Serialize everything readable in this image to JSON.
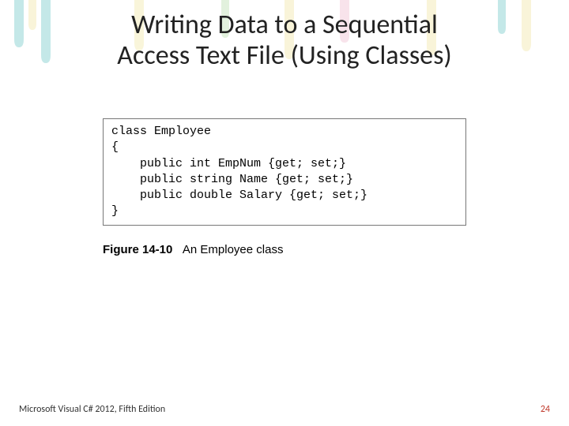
{
  "title_line1": "Writing Data to a Sequential",
  "title_line2": "Access Text File (Using Classes)",
  "code": "class Employee\n{\n    public int EmpNum {get; set;}\n    public string Name {get; set;}\n    public double Salary {get; set;}\n}",
  "caption_label": "Figure 14-10",
  "caption_text": "An Employee class",
  "footer_book": "Microsoft Visual C# 2012, Fifth Edition",
  "footer_page": "24"
}
